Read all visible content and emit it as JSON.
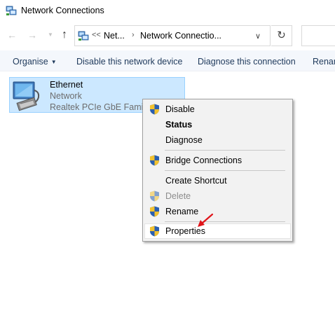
{
  "window": {
    "title": "Network Connections"
  },
  "address": {
    "chevrons": "<<",
    "crumb1": "Net...",
    "crumb2": "Network Connectio..."
  },
  "commands": {
    "organise": "Organise",
    "disable": "Disable this network device",
    "diagnose": "Diagnose this connection",
    "rename": "Renam"
  },
  "connection": {
    "name": "Ethernet",
    "status": "Network",
    "device": "Realtek PCIe GbE Family"
  },
  "context_menu": {
    "items": [
      {
        "label": "Disable",
        "icon": "shield-icon"
      },
      {
        "label": "Status"
      },
      {
        "label": "Diagnose"
      },
      {
        "label": "Bridge Connections",
        "icon": "shield-icon"
      },
      {
        "label": "Create Shortcut"
      },
      {
        "label": "Delete",
        "icon": "shield-icon",
        "disabled": true
      },
      {
        "label": "Rename",
        "icon": "shield-icon"
      },
      {
        "label": "Properties",
        "icon": "shield-icon",
        "highlighted": true
      }
    ]
  },
  "colors": {
    "selection_bg": "#cce8ff",
    "selection_border": "#99d1ff",
    "command_text": "#1e395b",
    "menu_bg": "#f2f2f2",
    "annotation_arrow": "#e0141a"
  }
}
